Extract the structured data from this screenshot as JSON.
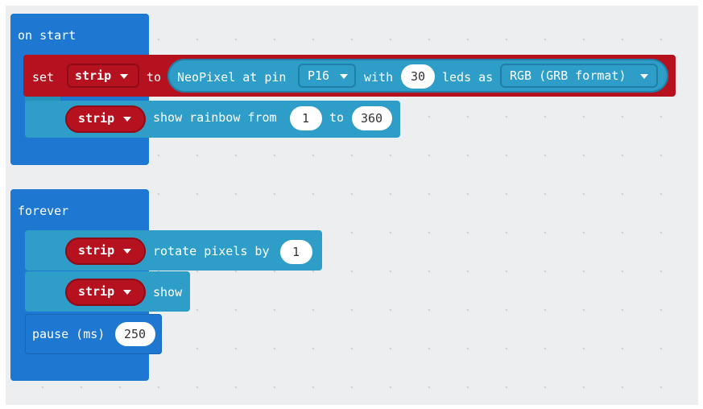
{
  "on_start": {
    "hat_label": "on start",
    "set_block": {
      "set_label": "set",
      "variable": "strip",
      "to_label": "to",
      "neopixel_label": "NeoPixel at pin",
      "pin": "P16",
      "with_label": "with",
      "leds_count": "30",
      "leds_label": "leds as",
      "mode": "RGB (GRB format)"
    },
    "rainbow_block": {
      "variable": "strip",
      "label": "show rainbow from",
      "from_value": "1",
      "to_label": "to",
      "to_value": "360"
    }
  },
  "forever": {
    "hat_label": "forever",
    "rotate_block": {
      "variable": "strip",
      "label": "rotate pixels by",
      "value": "1"
    },
    "show_block": {
      "variable": "strip",
      "label": "show"
    },
    "pause_block": {
      "label": "pause (ms)",
      "value": "250"
    }
  },
  "colors": {
    "event_blue": "#1e78d2",
    "neopixel_blue": "#2e9ec8",
    "variable_red": "#b5111f",
    "workspace_bg": "#eceeef"
  },
  "icons": {
    "dropdown": "caret-down-icon"
  }
}
